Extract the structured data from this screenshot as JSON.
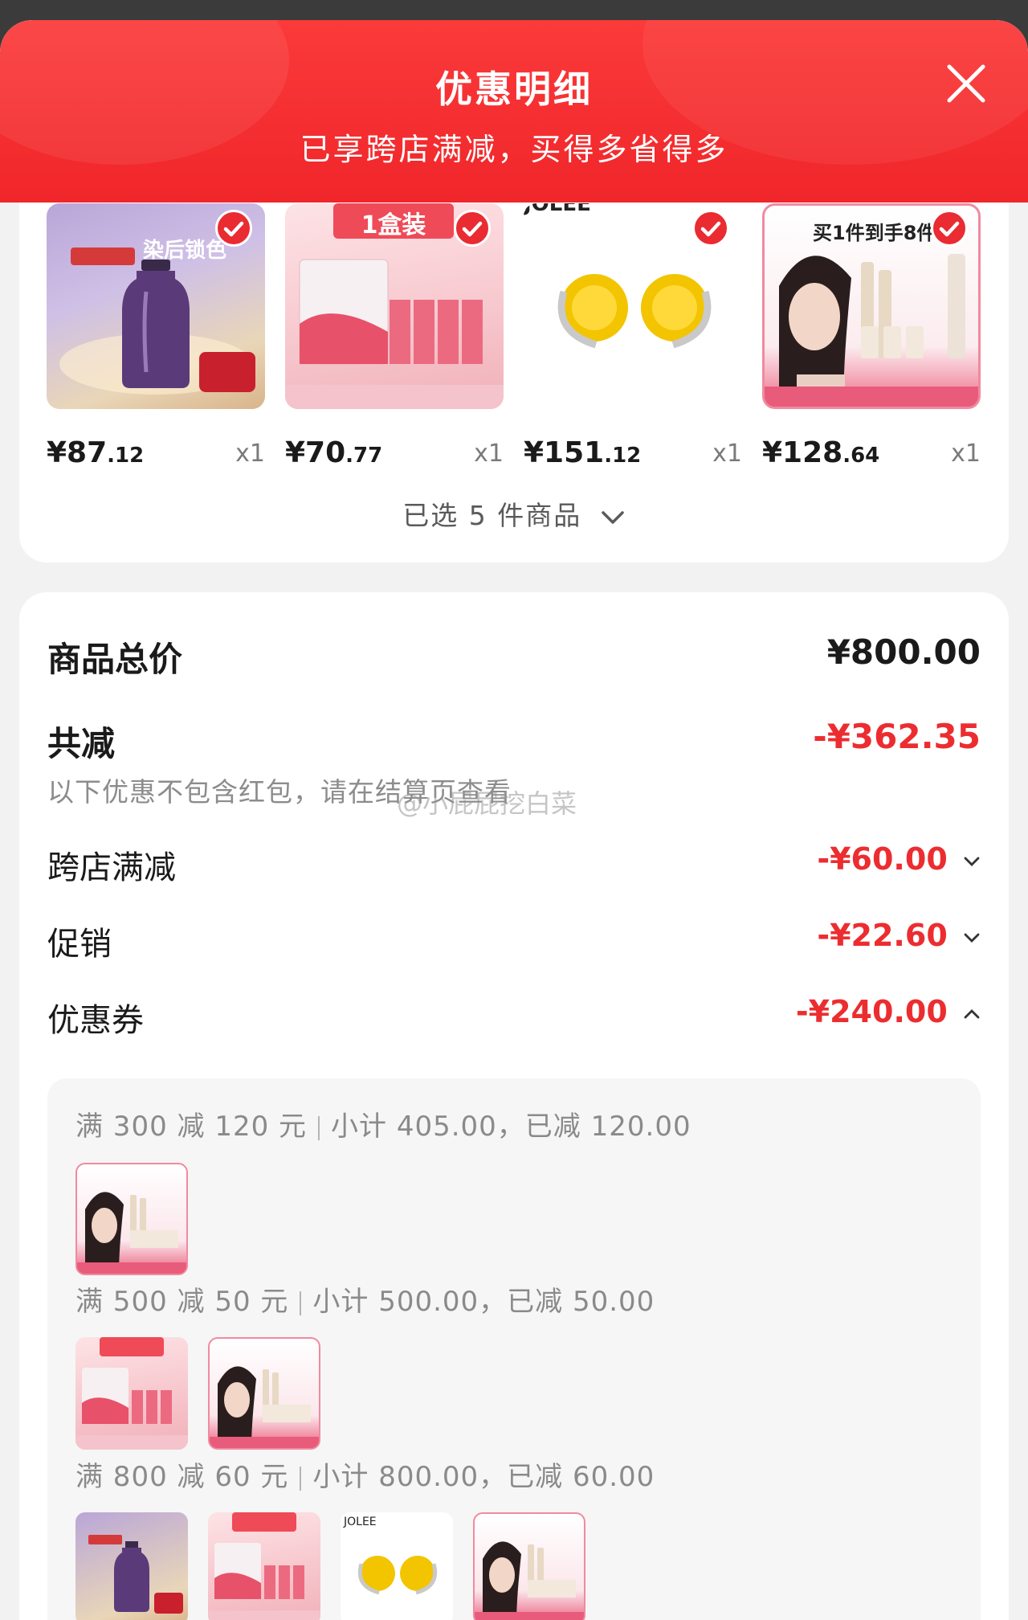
{
  "header": {
    "title": "优惠明细",
    "subtitle": "已享跨店满减，买得多省得多"
  },
  "products": [
    {
      "price_main": "¥87",
      "price_cents": ".12",
      "qty": "x1",
      "thumb_text": "染后锁色"
    },
    {
      "price_main": "¥70",
      "price_cents": ".77",
      "qty": "x1",
      "thumb_text": "1盒装"
    },
    {
      "price_main": "¥151",
      "price_cents": ".12",
      "qty": "x1",
      "thumb_text": "JOLEE"
    },
    {
      "price_main": "¥128",
      "price_cents": ".64",
      "qty": "x1",
      "thumb_text": "买1件到手8件"
    }
  ],
  "selected_toggle": "已选 5 件商品",
  "summary": {
    "total_label": "商品总价",
    "total_value": "¥800.00",
    "discount_label": "共减",
    "discount_value": "-¥362.35",
    "note": "以下优惠不包含红包，请在结算页查看",
    "watermark": "@小屁屁挖白菜",
    "items": [
      {
        "label": "跨店满减",
        "value": "-¥60.00"
      },
      {
        "label": "促销",
        "value": "-¥22.60"
      },
      {
        "label": "优惠券",
        "value": "-¥240.00"
      }
    ]
  },
  "coupon_tiers": [
    {
      "rule": "满 300 减 120 元",
      "detail": "小计 405.00，已减 120.00"
    },
    {
      "rule": "满 500 减 50 元",
      "detail": "小计 500.00，已减 50.00"
    },
    {
      "rule": "满 800 减 60 元",
      "detail": "小计 800.00，已减 60.00"
    }
  ],
  "colors": {
    "accent_red": "#ec2d30",
    "header_red": "#f0262a"
  }
}
